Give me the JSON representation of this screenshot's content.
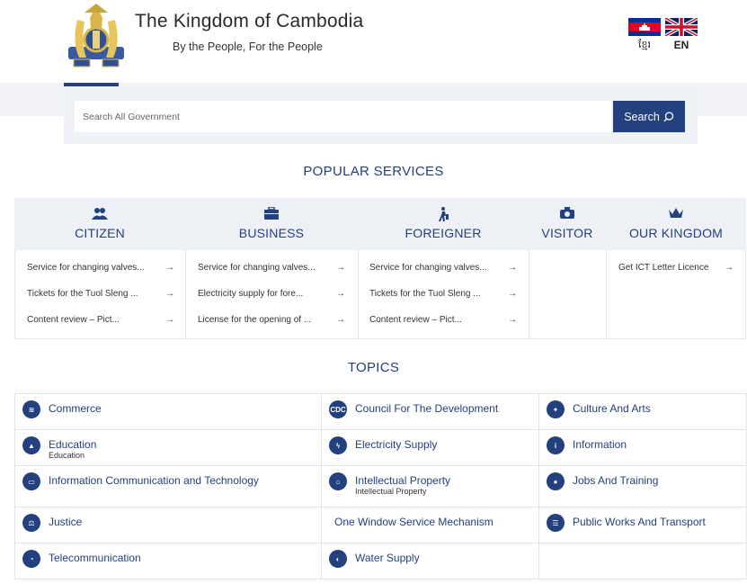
{
  "header": {
    "title": "The Kingdom of Cambodia",
    "subtitle": "By the People, For the People",
    "languages": [
      {
        "label": "ខ្មែរ",
        "flag": "cambodia-flag-icon"
      },
      {
        "label": "EN",
        "flag": "uk-flag-icon"
      }
    ]
  },
  "search": {
    "placeholder": "Search All Government",
    "button_label": "Search"
  },
  "popular_services": {
    "title": "POPULAR SERVICES",
    "columns": [
      {
        "name": "CITIZEN",
        "icon": "people-icon",
        "links": [
          "Service for changing valves...",
          "Tickets for the Tuol Sleng ...",
          "Content review – Pict..."
        ]
      },
      {
        "name": "BUSINESS",
        "icon": "briefcase-icon",
        "links": [
          "Service for changing valves...",
          "Electricity supply for fore...",
          "License for the opening of ..."
        ]
      },
      {
        "name": "FOREIGNER",
        "icon": "traveler-icon",
        "links": [
          "Service for changing valves...",
          "Tickets for the Tuol Sleng ...",
          "Content review – Pict..."
        ]
      },
      {
        "name": "VISITOR",
        "icon": "camera-icon",
        "links": []
      },
      {
        "name": "OUR KINGDOM",
        "icon": "crown-icon",
        "links": [
          "Get ICT Letter Licence"
        ]
      }
    ]
  },
  "topics": {
    "title": "TOPICS",
    "rows": [
      [
        {
          "label": "Commerce",
          "sub": "",
          "icon": "commerce-icon"
        },
        {
          "label": "Council For The Development",
          "sub": "",
          "icon": "cdc-icon",
          "icon_text": "CDC"
        },
        {
          "label": "Culture And Arts",
          "sub": "",
          "icon": "culture-icon"
        }
      ],
      [
        {
          "label": "Education",
          "sub": "Education",
          "icon": "education-icon"
        },
        {
          "label": "Electricity Supply",
          "sub": "",
          "icon": "electricity-icon"
        },
        {
          "label": "Information",
          "sub": "",
          "icon": "information-icon"
        }
      ],
      [
        {
          "label": "Information Communication and Technology",
          "sub": "",
          "icon": "computer-icon"
        },
        {
          "label": "Intellectual Property",
          "sub": "Intellectual Property",
          "icon": "intellectual-property-icon"
        },
        {
          "label": "Jobs And Training",
          "sub": "",
          "icon": "jobs-icon"
        }
      ],
      [
        {
          "label": "Justice",
          "sub": "",
          "icon": "justice-icon"
        },
        {
          "label": "One Window Service Mechanism",
          "sub": "",
          "icon": ""
        },
        {
          "label": "Public Works And Transport",
          "sub": "",
          "icon": "transport-icon"
        }
      ],
      [
        {
          "label": "Telecommunication",
          "sub": "",
          "icon": "telecom-icon"
        },
        {
          "label": "Water Supply",
          "sub": "",
          "icon": "water-supply-icon"
        },
        {
          "label": "",
          "sub": "",
          "icon": ""
        }
      ]
    ]
  },
  "colors": {
    "brand": "#23407f",
    "band": "#edf0f5",
    "border": "#dfe2e8"
  }
}
